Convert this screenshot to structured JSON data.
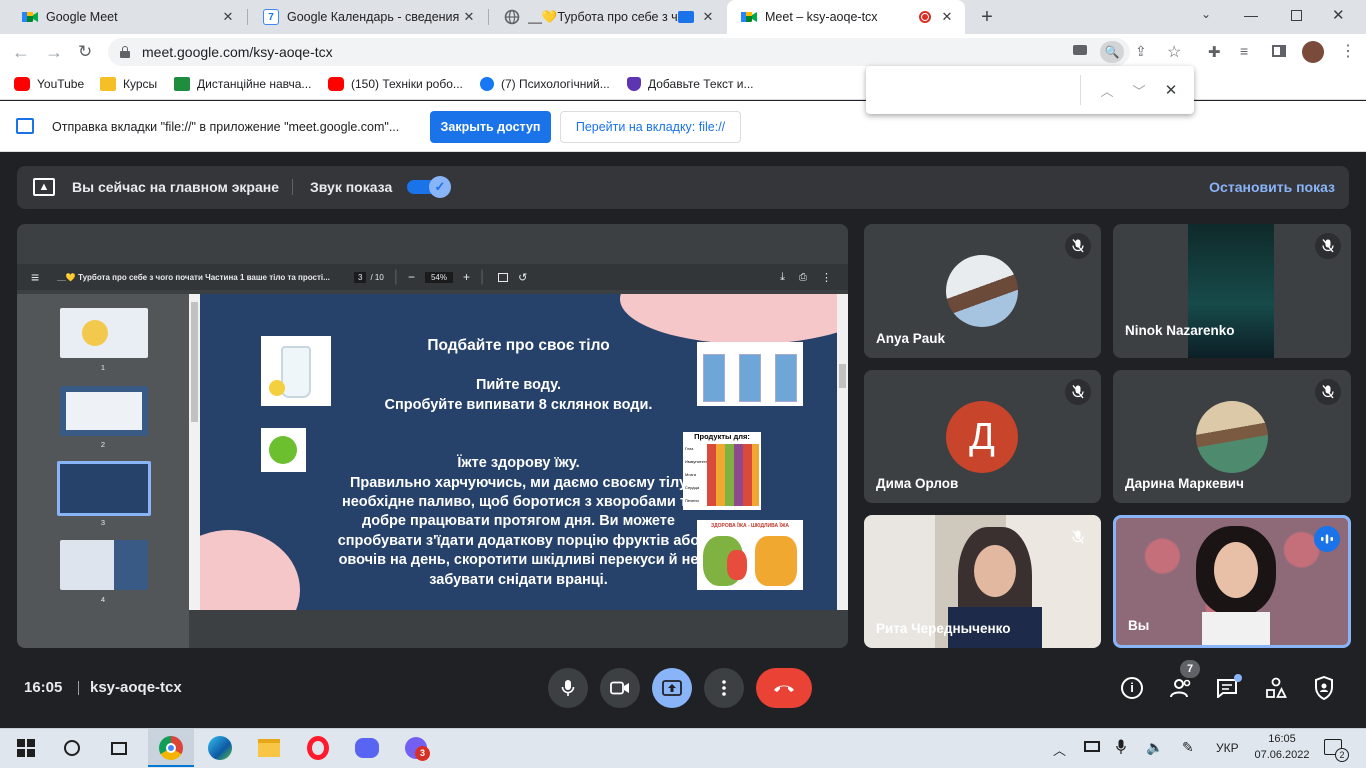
{
  "browser": {
    "tabs": [
      {
        "title": "Google Meet",
        "icon": "meet-icon"
      },
      {
        "title": "Google Календарь - сведения о",
        "icon": "calendar-icon"
      },
      {
        "title": "__💛Турбота про себе з чо",
        "icon": "globe-icon"
      },
      {
        "title": "Meet – ksy-aoqe-tcx",
        "icon": "meet-icon",
        "active": true
      }
    ],
    "url": "meet.google.com/ksy-aoqe-tcx",
    "bookmarks": [
      {
        "label": "YouTube",
        "icon": "youtube-icon"
      },
      {
        "label": "Курсы",
        "icon": "classroom-icon"
      },
      {
        "label": "Дистанційне навча...",
        "icon": "classroom-green-icon"
      },
      {
        "label": "(150) Техніки робо...",
        "icon": "youtube-icon"
      },
      {
        "label": "(7) Психологічний...",
        "icon": "facebook-icon"
      },
      {
        "label": "Добавьте Текст и...",
        "icon": "shield-icon"
      }
    ],
    "infobar": {
      "text": "Отправка вкладки \"file://\" в приложение \"meet.google.com\"...",
      "primary_button": "Закрыть доступ",
      "secondary_button": "Перейти на вкладку: file://"
    }
  },
  "meet": {
    "share_banner": {
      "text": "Вы сейчас на главном экране",
      "sound_label": "Звук показа",
      "stop_label": "Остановить показ"
    },
    "pdf": {
      "title": "__💛 Турбота про себе з чого почати Частина 1 ваше тіло та прості...",
      "page_current": "3",
      "page_total": "/ 10",
      "zoom": "54%",
      "thumbnail_numbers": [
        "1",
        "2",
        "3",
        "4"
      ],
      "slide": {
        "heading": "Подбайте про своє тіло",
        "water_line1": "Пийте воду.",
        "water_line2": "Спробуйте випивати 8 склянок води.",
        "food_heading": "Їжте здорову їжу.",
        "body_lines": [
          "Правильно харчуючись, ми даємо своєму тілу",
          "необхідне паливо, щоб боротися з хворобами та",
          "добре працювати протягом дня. Ви можете",
          "спробувати з'їдати додаткову порцію фруктів або",
          "овочів на день, скоротити шкідливі перекуси й не",
          "забувати снідати вранці."
        ],
        "products_title": "Продукты для:",
        "products_rows": [
          "Глаз",
          "Иммунитета",
          "Мозга",
          "Сердца",
          "Печени"
        ],
        "food_card_title": "ЗДОРОВА ЇЖА - ШКІДЛИВА ЇЖА"
      }
    },
    "participants": [
      {
        "name": "Anya Pauk",
        "muted": true
      },
      {
        "name": "Ninok Nazarenko",
        "muted": true
      },
      {
        "name": "Дима Орлов",
        "muted": true,
        "initial": "Д",
        "color": "#c8442a"
      },
      {
        "name": "Дарина Маркевич",
        "muted": true
      },
      {
        "name": "Рита Чередныченко",
        "muted": true
      },
      {
        "name": "Вы",
        "speaking": true
      }
    ],
    "footer": {
      "time": "16:05",
      "meeting_code": "ksy-aoqe-tcx",
      "people_count": "7"
    }
  },
  "taskbar": {
    "language": "УКР",
    "time": "16:05",
    "date": "07.06.2022",
    "viber_badge": "3",
    "notification_count": "2"
  },
  "colors": {
    "meet_bg": "#202124",
    "accent_blue": "#1a73e8",
    "end_call_red": "#ea4335",
    "share_active": "#8ab4f8",
    "slide_blue": "#26426b"
  }
}
